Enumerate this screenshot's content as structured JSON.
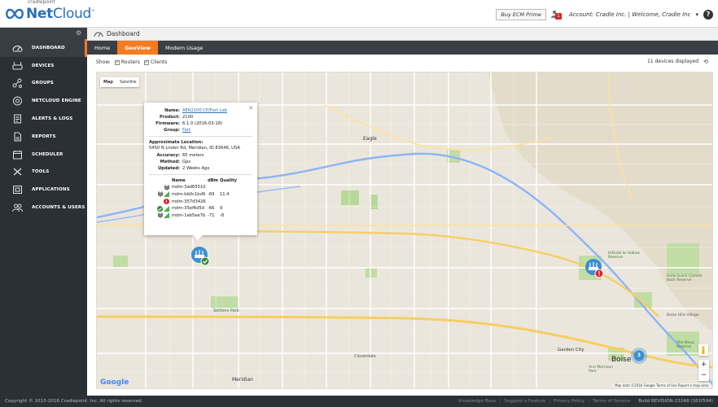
{
  "brand": {
    "small": "cradlepoint",
    "name_bold": "Net",
    "name_light": "Cloud",
    "tm": "™"
  },
  "header": {
    "buy_label": "Buy ECM Prime",
    "alert_count": "1",
    "account_text": "Account: Cradle Inc. | Welcome, Cradle Inc",
    "dropdown": "▾",
    "help": "?"
  },
  "sidebar": {
    "items": [
      {
        "label": "DASHBOARD",
        "icon": "dashboard-icon"
      },
      {
        "label": "DEVICES",
        "icon": "devices-icon"
      },
      {
        "label": "GROUPS",
        "icon": "groups-icon"
      },
      {
        "label": "NETCLOUD ENGINE",
        "icon": "netcloud-engine-icon"
      },
      {
        "label": "ALERTS & LOGS",
        "icon": "alerts-icon"
      },
      {
        "label": "REPORTS",
        "icon": "reports-icon"
      },
      {
        "label": "SCHEDULER",
        "icon": "calendar-icon"
      },
      {
        "label": "TOOLS",
        "icon": "tools-icon"
      },
      {
        "label": "APPLICATIONS",
        "icon": "applications-icon"
      },
      {
        "label": "ACCOUNTS & USERS",
        "icon": "users-icon"
      }
    ]
  },
  "breadcrumb": {
    "title": "Dashboard"
  },
  "tabs": [
    {
      "label": "Home"
    },
    {
      "label": "GeoView"
    },
    {
      "label": "Modem Usage"
    }
  ],
  "filters": {
    "show_label": "Show:",
    "routers": "Routers",
    "clients": "Clients",
    "device_count": "11 devices displayed"
  },
  "map": {
    "types": [
      {
        "label": "Map"
      },
      {
        "label": "Satellite"
      }
    ],
    "google": "Google",
    "attribution": "Map data ©2016 Google   Terms of Use   Report a map error",
    "zoom_in": "+",
    "zoom_out": "−",
    "cluster_count": "3",
    "labels": {
      "eagle": "Eagle",
      "settlers_park": "Settlers Park",
      "garden_city": "Garden City",
      "boise": "Boise",
      "cloverdale": "Cloverdale",
      "meridian": "Meridian",
      "hulls_gulch": "Hulls Gulch Camels Back Reserve",
      "boise_hills": "Boise Hills Village",
      "hillside": "Hillside to Hollow Reserve",
      "ann_morrison": "Ann Morrison Park",
      "the_mesa": "The Mesa Reserve"
    }
  },
  "popup": {
    "name_label": "Name:",
    "name_value": "AER2100 CP/Fort Lab",
    "product_label": "Product:",
    "product_value": "2100",
    "firmware_label": "Firmware:",
    "firmware_value": "6.1.0 (2016-03-18)",
    "group_label": "Group:",
    "group_value": "Fort",
    "approx_label": "Approximate Location:",
    "address": "5450 N Linder Rd, Meridian, ID 83646, USA",
    "accuracy_label": "Accuracy:",
    "accuracy_value": "65 meters",
    "method_label": "Method:",
    "method_value": "Gps",
    "updated_label": "Updated:",
    "updated_value": "2 Weeks Ago",
    "col_name": "Name",
    "col_dbm": "dBm",
    "col_quality": "Quality",
    "clients": [
      {
        "name": "mdm-3ad65510",
        "dbm": "",
        "quality": "",
        "status": "plug"
      },
      {
        "name": "mdm-bb0c1bd9",
        "dbm": "-69",
        "quality": "11.4",
        "status": "signal"
      },
      {
        "name": "mdm-357d3426",
        "dbm": "",
        "quality": "",
        "status": "error"
      },
      {
        "name": "mdm-35ef6d5d",
        "dbm": "-66",
        "quality": "9",
        "status": "ok-signal"
      },
      {
        "name": "mdm-1eb5ee7b",
        "dbm": "-71",
        "quality": "-8",
        "status": "signal"
      }
    ]
  },
  "footer": {
    "copyright": "Copyright © 2013-2016 Cradlepoint, Inc. All rights reserved.",
    "links": [
      "Knowledge Base",
      "Suggest a Feature",
      "Privacy Policy",
      "Terms of Service"
    ],
    "build": "Build REVISION-13248 (161f594)"
  },
  "colors": {
    "accent": "#f47b20",
    "sidebar": "#2b3036",
    "brand": "#2a6fb5",
    "error": "#d9232d",
    "ok": "#2e8b2e"
  }
}
